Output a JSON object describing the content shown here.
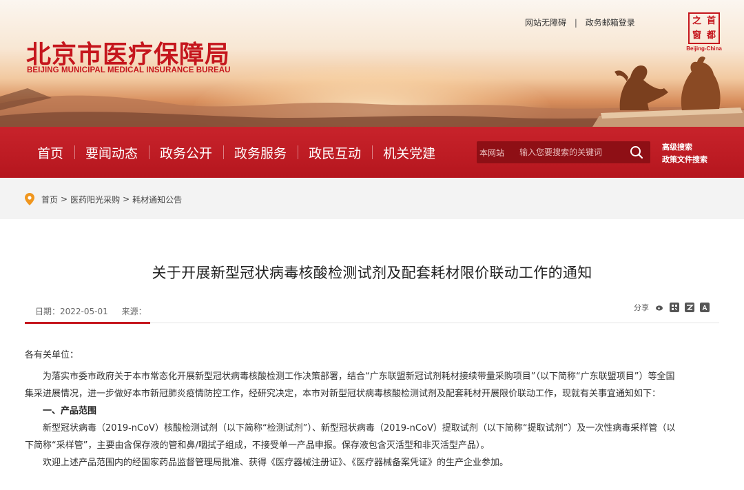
{
  "header": {
    "logo_cn": "北京市医疗保障局",
    "logo_en": "BEIJING MUNICIPAL MEDICAL INSURANCE BUREAU",
    "top_links": [
      "网站无障碍",
      "政务邮箱登录"
    ],
    "top_links_sep": "|",
    "seal_chars": [
      "之",
      "首",
      "窗",
      "都"
    ],
    "seal_caption": "Beijing-China"
  },
  "nav": {
    "items": [
      "首页",
      "要闻动态",
      "政务公开",
      "政务服务",
      "政民互动",
      "机关党建"
    ],
    "search_scope": "本网站",
    "search_placeholder": "输入您要搜索的关键词",
    "advanced_search": "高级搜索",
    "policy_search": "政策文件搜索"
  },
  "breadcrumb": {
    "items": [
      "首页",
      "医药阳光采购",
      "耗材通知公告"
    ],
    "separator": ">"
  },
  "article": {
    "title": "关于开展新型冠状病毒核酸检测试剂及配套耗材限价联动工作的通知",
    "date_label": "日期：2022-05-01",
    "source_label": "来源：",
    "share_label": "分享",
    "greeting": "各有关单位：",
    "para1": "为落实市委市政府关于本市常态化开展新型冠状病毒核酸检测工作决策部署，结合“广东联盟新冠试剂耗材接续带量采购项目”（以下简称“广东联盟项目”）等全国",
    "para1_cont": "集采进展情况，进一步做好本市新冠肺炎疫情防控工作，经研究决定，本市对新型冠状病毒核酸检测试剂及配套耗材开展限价联动工作，现就有关事宜通知如下：",
    "section1": "一、产品范围",
    "para2": "新型冠状病毒（2019-nCoV）核酸检测试剂（以下简称“检测试剂”）、新型冠状病毒（2019-nCoV）提取试剂（以下简称“提取试剂”）及一次性病毒采样管（以",
    "para2_cont": "下简称“采样管”，主要由含保存液的管和鼻/咽拭子组成，不接受单一产品申报。保存液包含灭活型和非灭活型产品）。",
    "para3": "欢迎上述产品范围内的经国家药品监督管理局批准、获得《医疗器械注册证》、《医疗器械备案凭证》的生产企业参加。"
  },
  "colors": {
    "brand_red": "#c5161d",
    "nav_red": "#b5161e"
  }
}
